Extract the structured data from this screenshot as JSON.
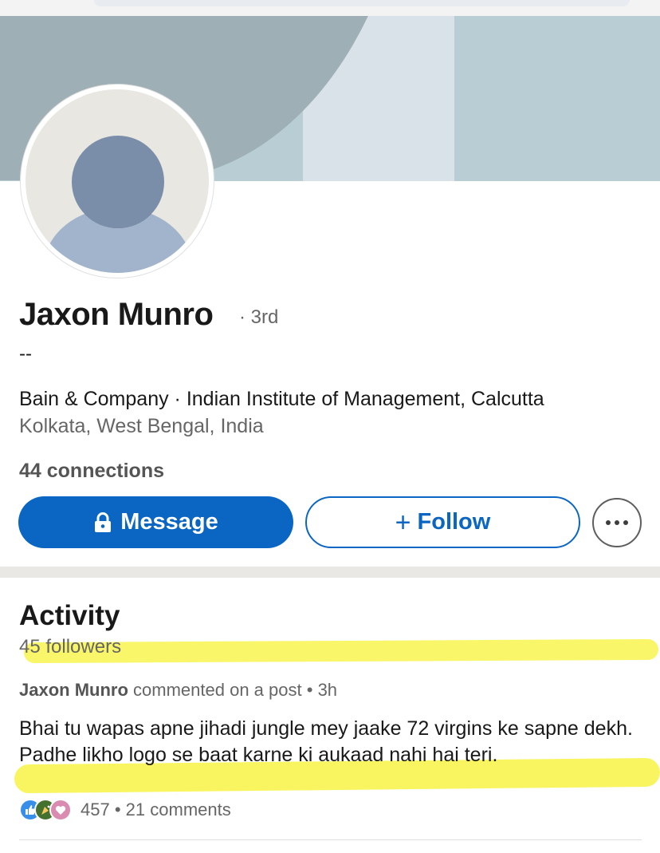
{
  "profile": {
    "name": "Jaxon Munro",
    "degree": "· 3rd",
    "headline": "--",
    "organization": "Bain & Company · Indian Institute of Management, Calcutta",
    "location": "Kolkata, West Bengal, India",
    "connections": "44 connections"
  },
  "actions": {
    "message_label": "Message",
    "follow_label": "Follow",
    "follow_prefix": "+",
    "more_icon": "more-horizontal-icon"
  },
  "activity": {
    "title": "Activity",
    "followers": "45 followers",
    "post": {
      "author": "Jaxon Munro",
      "action": "commented on a post",
      "time": "3h",
      "separator": "•",
      "comment": "Bhai tu wapas apne jihadi jungle mey jaake 72 virgins ke sapne dekh. Padhe likho logo se baat karne ki aukaad nahi hai teri.",
      "reaction_count": "457",
      "comments_count": "21 comments",
      "reactions_separator": "•"
    }
  },
  "colors": {
    "primary": "#0a66c2",
    "highlight": "#f7f338",
    "banner": "#b9ced4"
  }
}
